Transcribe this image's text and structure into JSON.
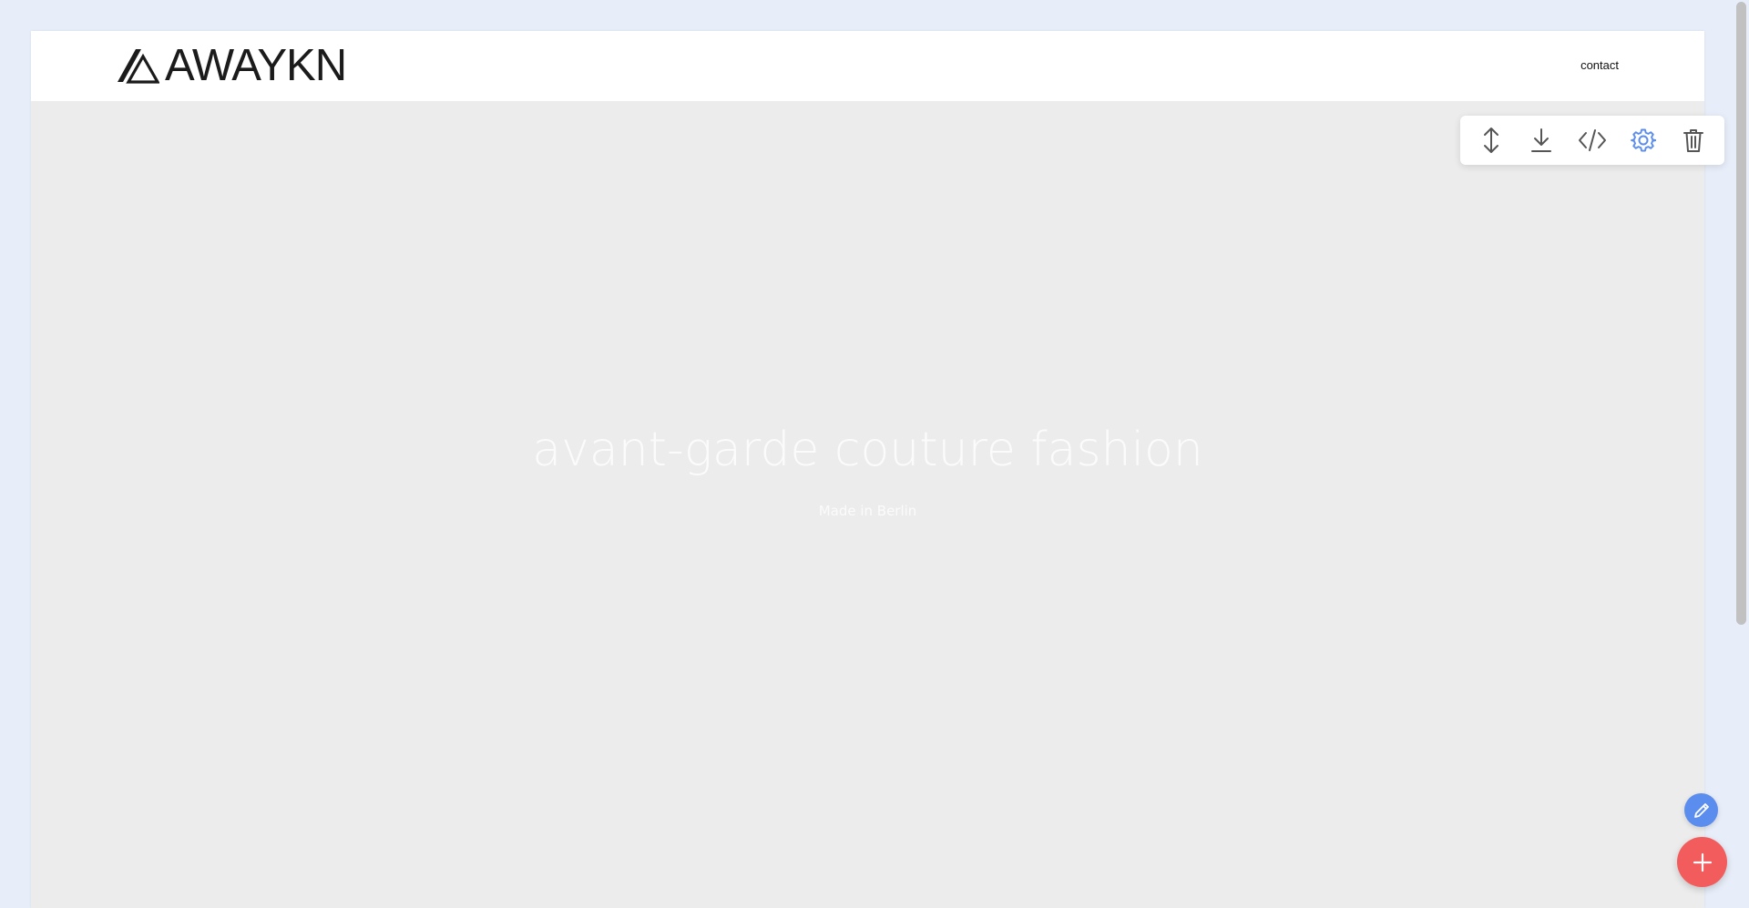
{
  "header": {
    "logo_text": "AWAYKN",
    "contact_label": "contact"
  },
  "hero": {
    "title": "avant-garde couture fashion",
    "subtitle": "Made in Berlin"
  },
  "toolbar": {
    "items": [
      {
        "name": "resize-vertical",
        "icon": "arrows-up-down-icon"
      },
      {
        "name": "download",
        "icon": "download-icon"
      },
      {
        "name": "code",
        "icon": "code-icon"
      },
      {
        "name": "settings",
        "icon": "gear-icon",
        "active": true
      },
      {
        "name": "delete",
        "icon": "trash-icon"
      }
    ]
  },
  "colors": {
    "page_background": "#e8eef9",
    "hero_background": "#ececec",
    "hero_text": "#fbfbfb",
    "active_icon": "#5b8def",
    "icon_default": "#555555",
    "fab_edit": "#5b8def",
    "fab_add": "#f25c5c"
  }
}
